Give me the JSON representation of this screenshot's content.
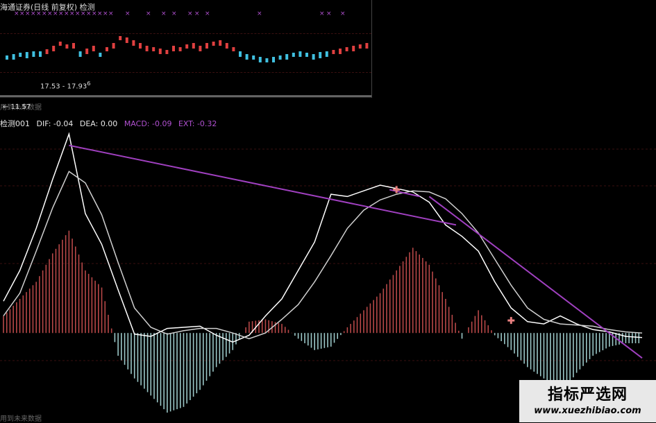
{
  "price_panel": {
    "title": "海通证券(日线 前复权) 检测",
    "range_label": "17.53 - 17.93",
    "range_suffix": "6",
    "low_label": "← 11.57",
    "future_label": "用到未来数据"
  },
  "indicator_panel": {
    "legend": {
      "name": "检测001",
      "dif": "DIF: -0.04",
      "dea": "DEA: 0.00",
      "macd": "MACD: -0.09",
      "ext": "EXT: -0.32"
    },
    "future_label": "用到未来数据"
  },
  "watermark": {
    "title": "指标严选网",
    "url": "www.xuezhibiao.com"
  },
  "colors": {
    "positive_bar": "#b84848",
    "negative_bar": "#9cc8c8",
    "dif_line": "#ffffff",
    "dea_line": "#cfcfcf",
    "divergence_line": "#a040c0",
    "signal_marker": "#e88080",
    "candle_up": "#e04040",
    "candle_down": "#40c0e0"
  },
  "chart_data": {
    "type": "line",
    "title": "检测001",
    "indicator": "MACD",
    "current_values": {
      "DIF": -0.04,
      "DEA": 0.0,
      "MACD": -0.09,
      "EXT": -0.32
    },
    "x": [
      0,
      5,
      10,
      15,
      20,
      25,
      30,
      35,
      40,
      45,
      50,
      55,
      60,
      65,
      70,
      75,
      80,
      85,
      90,
      95,
      100,
      105,
      110,
      115,
      120,
      125,
      130,
      135,
      140,
      145,
      150,
      155,
      160,
      165,
      170,
      175,
      180,
      185,
      190,
      195
    ],
    "series": [
      {
        "name": "DIF",
        "values": [
          0.28,
          0.55,
          0.92,
          1.35,
          1.75,
          1.05,
          0.78,
          0.38,
          -0.01,
          -0.03,
          0.04,
          0.05,
          0.06,
          -0.02,
          -0.08,
          -0.02,
          0.15,
          0.3,
          0.55,
          0.8,
          1.22,
          1.2,
          1.25,
          1.3,
          1.27,
          1.24,
          1.15,
          0.95,
          0.85,
          0.72,
          0.45,
          0.22,
          0.1,
          0.08,
          0.15,
          0.08,
          0.03,
          0.01,
          -0.03,
          -0.04
        ]
      },
      {
        "name": "DEA",
        "values": [
          0.15,
          0.35,
          0.72,
          1.1,
          1.42,
          1.32,
          1.04,
          0.62,
          0.22,
          0.05,
          -0.01,
          0.02,
          0.04,
          0.04,
          0.0,
          -0.05,
          0.0,
          0.12,
          0.25,
          0.45,
          0.68,
          0.92,
          1.08,
          1.17,
          1.22,
          1.25,
          1.24,
          1.18,
          1.05,
          0.88,
          0.65,
          0.42,
          0.22,
          0.12,
          0.08,
          0.07,
          0.06,
          0.03,
          0.01,
          0.0
        ]
      }
    ],
    "histogram": [
      0.15,
      0.3,
      0.45,
      0.7,
      0.9,
      0.55,
      0.4,
      -0.2,
      -0.4,
      -0.55,
      -0.7,
      -0.65,
      -0.5,
      -0.3,
      -0.15,
      0.1,
      0.12,
      0.08,
      -0.05,
      -0.15,
      -0.12,
      0.05,
      0.2,
      0.35,
      0.55,
      0.75,
      0.6,
      0.3,
      -0.05,
      0.2,
      -0.02,
      -0.15,
      -0.3,
      -0.4,
      -0.55,
      -0.35,
      -0.2,
      -0.12,
      -0.09,
      -0.09
    ],
    "ylim": [
      -0.7,
      1.8
    ]
  }
}
